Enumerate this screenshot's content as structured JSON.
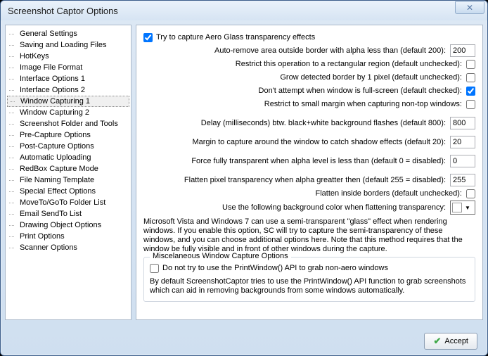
{
  "window": {
    "title": "Screenshot Captor Options"
  },
  "sidebar": {
    "items": [
      {
        "label": "General Settings"
      },
      {
        "label": "Saving and Loading Files"
      },
      {
        "label": "HotKeys"
      },
      {
        "label": "Image File Format"
      },
      {
        "label": "Interface Options 1"
      },
      {
        "label": "Interface Options 2"
      },
      {
        "label": "Window Capturing 1"
      },
      {
        "label": "Window Capturing 2"
      },
      {
        "label": "Screenshot Folder and Tools"
      },
      {
        "label": "Pre-Capture Options"
      },
      {
        "label": "Post-Capture Options"
      },
      {
        "label": "Automatic Uploading"
      },
      {
        "label": "RedBox Capture Mode"
      },
      {
        "label": "File Naming Template"
      },
      {
        "label": "Special Effect Options"
      },
      {
        "label": "MoveTo/GoTo Folder List"
      },
      {
        "label": "Email SendTo List"
      },
      {
        "label": "Drawing Object Options"
      },
      {
        "label": "Print Options"
      },
      {
        "label": "Scanner Options"
      }
    ],
    "selected_index": 6
  },
  "options": {
    "aero_label": "Try to capture Aero Glass transparency effects",
    "aero_checked": true,
    "auto_remove_label": "Auto-remove area outside border with alpha less than (default 200):",
    "auto_remove_value": "200",
    "restrict_rect_label": "Restrict this operation to a rectangular region (default unchecked):",
    "restrict_rect_checked": false,
    "grow_border_label": "Grow detected border by 1 pixel (default unchecked):",
    "grow_border_checked": false,
    "fullscreen_label": "Don't attempt when window is full-screen (default checked):",
    "fullscreen_checked": true,
    "smallmargin_label": "Restrict to small margin when capturing non-top windows:",
    "smallmargin_checked": false,
    "delay_label": "Delay (milliseconds) btw. black+white background flashes (default 800):",
    "delay_value": "800",
    "margin_label": "Margin to capture around the window to catch shadow effects (default 20):",
    "margin_value": "20",
    "force_transparent_label": "Force fully transparent when alpha level is less than (default 0 = disabled):",
    "force_transparent_value": "0",
    "flatten_label": "Flatten pixel transparency when alpha greatter then (default 255 = disabled):",
    "flatten_value": "255",
    "flatten_inside_label": "Flatten inside borders (default unchecked):",
    "flatten_inside_checked": false,
    "bgcolor_label": "Use the following background color when flattening transparency:",
    "description": "Microsoft Vista and Windows 7 can use a semi-transparent \"glass\" effect when rendering windows.  If you enable this option, SC will try to capture the semi-transparency of these windows, and you can choose additional options here.  Note that this method requires that the window be fully visible and in front of other windows during the capture.",
    "misc_title": "Miscelaneous Window Capture Options",
    "printwindow_label": "Do not try to use the PrintWindow() API to grab non-aero windows",
    "printwindow_checked": false,
    "printwindow_desc": "By default ScreenshotCaptor tries to use the PrintWindow() API function to grab screenshots which can aid in removing backgrounds from some windows automatically."
  },
  "footer": {
    "accept": "Accept"
  }
}
